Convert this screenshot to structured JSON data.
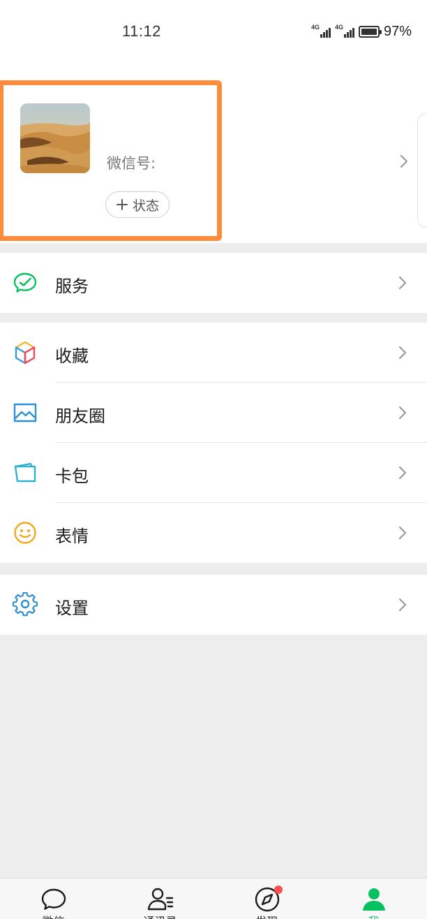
{
  "status_bar": {
    "time": "11:12",
    "network_1": "4G",
    "network_2": "4G",
    "battery": "97%"
  },
  "profile": {
    "wechat_id_label": "微信号:",
    "status_button": "状态",
    "highlight_color": "#ff8c3a"
  },
  "menu": {
    "services": "服务",
    "favorites": "收藏",
    "moments": "朋友圈",
    "cards": "卡包",
    "stickers": "表情",
    "settings": "设置"
  },
  "tabs": {
    "chats": "微信",
    "contacts": "通讯录",
    "discover": "发现",
    "me": "我"
  },
  "colors": {
    "accent_green": "#07c160",
    "badge_red": "#fa5151",
    "background": "#ededed"
  }
}
